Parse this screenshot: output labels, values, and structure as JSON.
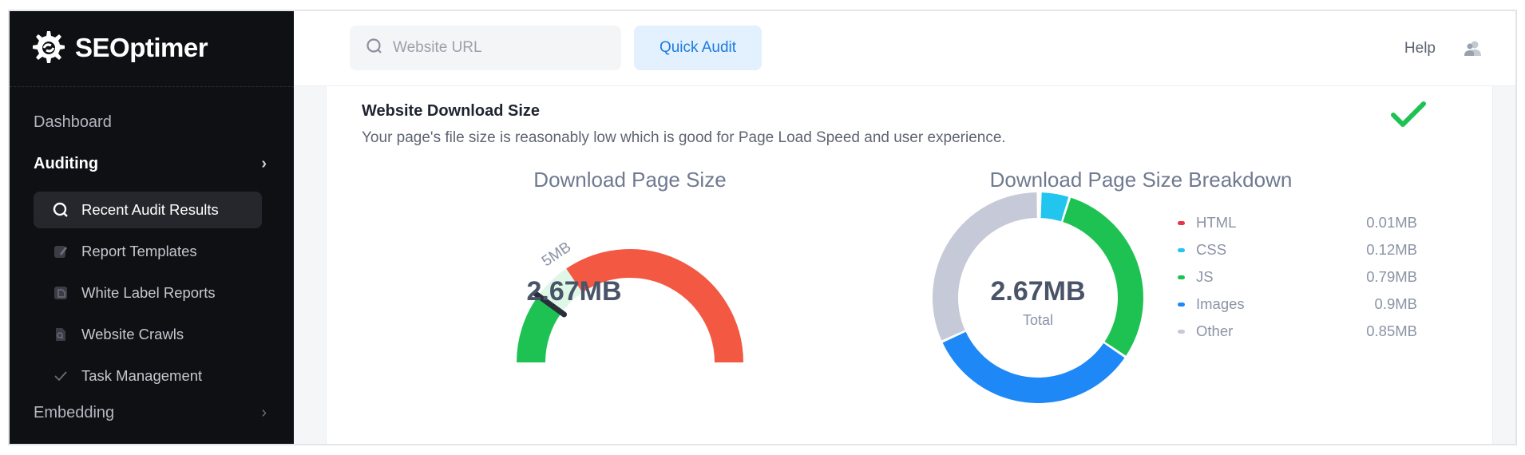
{
  "app": {
    "brand": "SEOptimer"
  },
  "sidebar": {
    "sections": [
      {
        "label": "Dashboard"
      },
      {
        "label": "Auditing"
      },
      {
        "label": "Embedding"
      }
    ],
    "items": [
      {
        "label": "Recent Audit Results",
        "icon": "search-icon"
      },
      {
        "label": "Report Templates",
        "icon": "pencil-icon"
      },
      {
        "label": "White Label Reports",
        "icon": "document-icon"
      },
      {
        "label": "Website Crawls",
        "icon": "file-search-icon"
      },
      {
        "label": "Task Management",
        "icon": "check-icon"
      }
    ]
  },
  "topbar": {
    "search_placeholder": "Website URL",
    "search_value": "",
    "quick_audit_label": "Quick Audit",
    "help_label": "Help"
  },
  "card": {
    "title": "Website Download Size",
    "description": "Your page's file size is reasonably low which is good for Page Load Speed and user experience.",
    "status": "pass"
  },
  "gauge": {
    "title": "Download Page Size",
    "value_label": "2.67MB",
    "value_mb": 2.67,
    "threshold_label": "5MB",
    "threshold_mb": 5
  },
  "chart_data": {
    "type": "pie",
    "title": "Download Page Size Breakdown",
    "center_value": "2.67MB",
    "center_label": "Total",
    "categories": [
      "HTML",
      "CSS",
      "JS",
      "Images",
      "Other"
    ],
    "values": [
      0.01,
      0.12,
      0.79,
      0.9,
      0.85
    ],
    "value_labels": [
      "0.01MB",
      "0.12MB",
      "0.79MB",
      "0.9MB",
      "0.85MB"
    ],
    "colors": [
      "#e8334a",
      "#22c5ee",
      "#1ec253",
      "#1e88f7",
      "#c6cad8"
    ],
    "legend_position": "right"
  },
  "colors": {
    "gauge_green": "#1ec253",
    "gauge_light": "#dff7e7",
    "gauge_red": "#f25842",
    "check_green": "#1ec253",
    "accent_blue": "#1d7be0"
  }
}
